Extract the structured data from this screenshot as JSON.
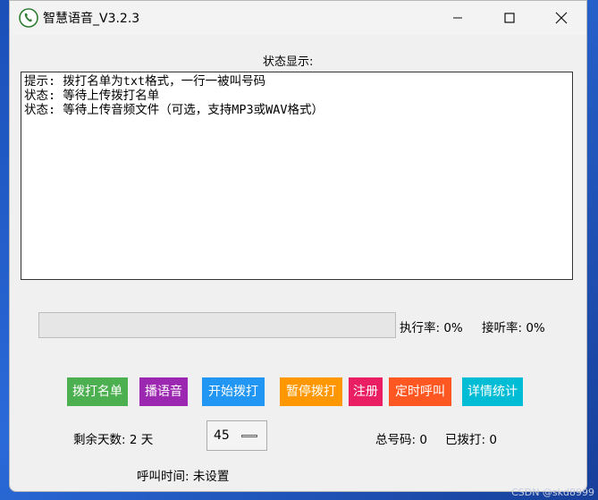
{
  "window": {
    "title": "智慧语音_V3.2.3",
    "icon": "phone-icon"
  },
  "status": {
    "label": "状态显示:",
    "lines": [
      "提示: 拨打名单为txt格式，一行一被叫号码",
      "状态: 等待上传拨打名单",
      "状态: 等待上传音频文件（可选，支持MP3或WAV格式）"
    ]
  },
  "progress": {
    "value": 0,
    "exec_rate": "执行率: 0%",
    "answer_rate": "接听率: 0%"
  },
  "buttons": [
    {
      "label": "拨打名单",
      "color": "#4caf50"
    },
    {
      "label": "播语音",
      "color": "#9c27b0"
    },
    {
      "label": "开始拨打",
      "color": "#2196f3"
    },
    {
      "label": "暂停拨打",
      "color": "#ff9800"
    },
    {
      "label": "注册",
      "color": "#e91e63"
    },
    {
      "label": "定时呼叫",
      "color": "#ff5722"
    },
    {
      "label": "详情统计",
      "color": "#00bcd4"
    }
  ],
  "info": {
    "days_left": "剩余天数: 2 天",
    "select_value": "45",
    "total_numbers": "总号码: 0",
    "dialed": "已拨打: 0",
    "call_time": "呼叫时间: 未设置"
  },
  "watermark": "CSDN @skd8999"
}
